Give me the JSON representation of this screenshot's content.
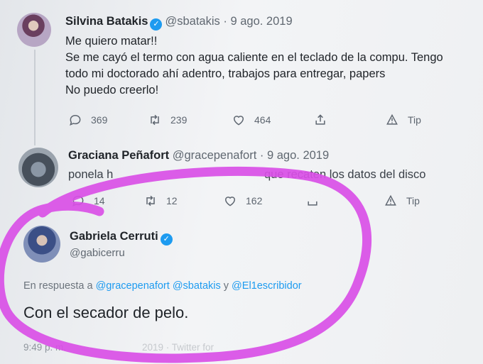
{
  "colors": {
    "accent": "#1d9bf0",
    "annotation": "#d94fe6"
  },
  "tweets": [
    {
      "author_name": "Silvina Batakis",
      "author_handle": "@sbatakis",
      "separator": "·",
      "date": "9 ago. 2019",
      "lines": [
        "Me quiero matar!!",
        "Se me cayó el termo con agua caliente en el teclado de la compu. Tengo",
        "todo mi doctorado ahí adentro, trabajos para entregar, papers",
        "No puedo creerlo!"
      ],
      "replies": "369",
      "retweets": "239",
      "likes": "464",
      "tip_label": "Tip"
    },
    {
      "author_name": "Graciana Peñafort",
      "author_handle": "@gracepenafort",
      "separator": "·",
      "date": "9 ago. 2019",
      "text_start": "ponela h",
      "text_end": "que recaten los datos del disco",
      "replies": "14",
      "retweets": "12",
      "likes": "162",
      "tip_label": "Tip"
    }
  ],
  "focused_tweet": {
    "author_name": "Gabriela Cerruti",
    "author_handle": "@gabicerru",
    "reply_prefix": "En respuesta a",
    "mention_1": "@gracepenafort",
    "mention_2": "@sbatakis",
    "conjunction": "y",
    "mention_3": "@El1escribidor",
    "text": "Con el secador de pelo.",
    "time": "9:49 p. m.",
    "meta_rest": "2019 · Twitter for"
  }
}
